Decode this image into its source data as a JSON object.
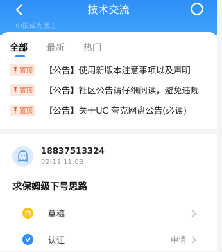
{
  "header": {
    "title": "技术交流",
    "faded_text": "中国成为版主"
  },
  "tabs": [
    "全部",
    "最新",
    "热门"
  ],
  "notices": [
    {
      "badge": "置顶",
      "text": "【公告】使用新版本注意事项以及声明"
    },
    {
      "badge": "置顶",
      "text": "【公告】社区公告请仔细阅读，避免违规"
    },
    {
      "badge": "置顶",
      "text": "【公告】关于UC 夸克网盘公告(必读)"
    }
  ],
  "post": {
    "username": "18837513324",
    "time": "02-11 11:03",
    "title": "求保姆级下号思路"
  },
  "rows": [
    {
      "label": "草稿",
      "value": ""
    },
    {
      "label": "认证",
      "value": "申请"
    }
  ],
  "colors": {
    "accent": "#2f8ff8",
    "pin_bg": "#fde8df",
    "pin_text": "#f05a28",
    "draft_icon": "#f5c518",
    "verify_icon": "#2f8ff8"
  }
}
